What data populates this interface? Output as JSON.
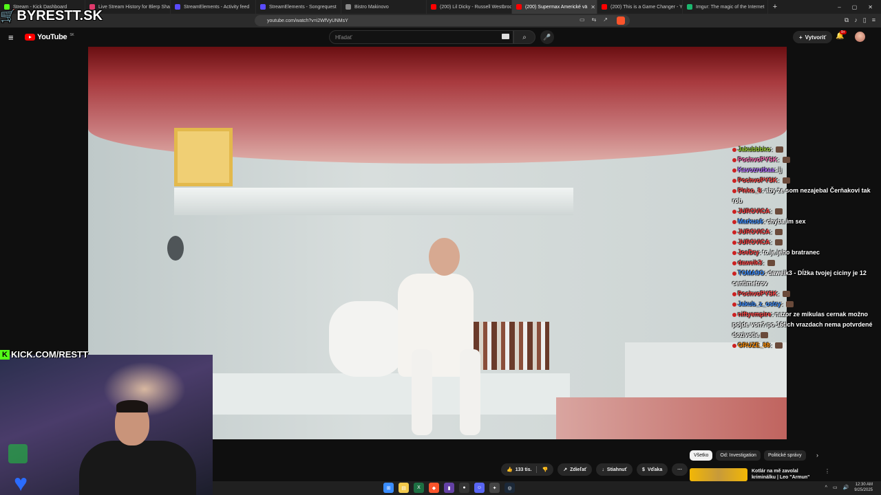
{
  "browser": {
    "tabs": [
      {
        "title": "Stream - Kick Dashboard",
        "color": "#53fc18"
      },
      {
        "title": "Live Stream History for Blerp Shares",
        "color": "#e03a6c"
      },
      {
        "title": "StreamElements - Activity feed",
        "color": "#5a4bff"
      },
      {
        "title": "StreamElements - Songrequest",
        "color": "#5a4bff"
      },
      {
        "title": "Bistro Makinovo",
        "color": "#888888"
      },
      {
        "title": "(200) Lil Dicky - Russell Westbrook Cr",
        "color": "#ff0000"
      },
      {
        "title": "(200) Supermax Americké vä",
        "color": "#ff0000",
        "active": true
      },
      {
        "title": "(200) This is a Game Changer - YouT",
        "color": "#ff0000"
      },
      {
        "title": "Imgur: The magic of the Internet",
        "color": "#1bb76e"
      }
    ],
    "url": "youtube.com/watch?v=i2WfVyUNMsY",
    "new_tab": "+",
    "window_controls": [
      "–",
      "▢",
      "✕"
    ]
  },
  "overlay": {
    "brand_text": "BYRESTT.SK",
    "kick_text": "KICK.COM/RESTT",
    "kick_letter": "K"
  },
  "youtube": {
    "logo_text": "YouTube",
    "region": "SK",
    "search_placeholder": "Hľadať",
    "create_label": "Vytvoriť",
    "notif_badge": "9+",
    "chips": [
      "Všetko",
      "Od: Investigation",
      "Politické správy"
    ],
    "actions": {
      "likes": "133 tis.",
      "share": "Zdieľať",
      "download": "Stiahnuť",
      "thanks": "Vďaka",
      "more": "···"
    },
    "recommended": {
      "title": "Kotlár na mě zavolal kriminálku | Leo \"Armun\" Benicak |"
    }
  },
  "chat": [
    {
      "user": "Jakubbbko",
      "color": "#9acd32",
      "text": "",
      "emote": true
    },
    {
      "user": "PochvoPYSK",
      "color": "#ff69b4",
      "text": "",
      "emote": true
    },
    {
      "user": "Kavozrutkaa",
      "color": "#b36bff",
      "text": "jj",
      "emote": false
    },
    {
      "user": "PochvoPYSK",
      "color": "#ff4444",
      "text": "",
      "emote": true
    },
    {
      "user": "Pleko_8",
      "color": "#ff4d4d",
      "text": "aby že som nezajebal Čerňakovi tak rob",
      "emote": false
    },
    {
      "user": "JUROVICA",
      "color": "#ff4444",
      "text": "",
      "emote": true
    },
    {
      "user": "Markus6",
      "color": "#3a8dff",
      "text": "chyba im sex",
      "emote": false
    },
    {
      "user": "JUROVICA",
      "color": "#ff4444",
      "text": "",
      "emote": true
    },
    {
      "user": "JUROVICA",
      "color": "#ff4444",
      "text": "",
      "emote": true
    },
    {
      "user": "JoeDry",
      "color": "#ff4444",
      "text": "to je jeho bratranec",
      "emote": false
    },
    {
      "user": "daweik3",
      "color": "#ff4444",
      "text": "",
      "emote": true
    },
    {
      "user": "TOMA9O",
      "color": "#3a8dff",
      "text": "daweik3 - Dĺžka tvojej ciciny je 12 centimetrov",
      "emote": false
    },
    {
      "user": "PochvoPYSK",
      "color": "#ff4444",
      "text": "",
      "emote": true
    },
    {
      "user": "Jakub_z_ostry",
      "color": "#3a8dff",
      "text": "",
      "emote": true
    },
    {
      "user": "niftyempire",
      "color": "#ff4444",
      "text": "nazor ze mikulas cernak možno pojde von? po 16tich vrazdach nema potvrdené dozivotie",
      "emote": true
    },
    {
      "user": "GRUZE_88",
      "color": "#ff8c00",
      "text": "",
      "emote": true
    }
  ],
  "taskbar": {
    "time": "12:30 AM",
    "date": "9/25/2025",
    "tray_arrow": "^"
  },
  "icons": {
    "menu": "hamburger-icon",
    "search": "search-icon",
    "mic": "microphone-icon",
    "bell": "bell-icon",
    "like": "thumbs-up-icon",
    "dislike": "thumbs-down-icon",
    "share": "share-icon",
    "download": "download-icon",
    "thanks": "thanks-icon"
  }
}
